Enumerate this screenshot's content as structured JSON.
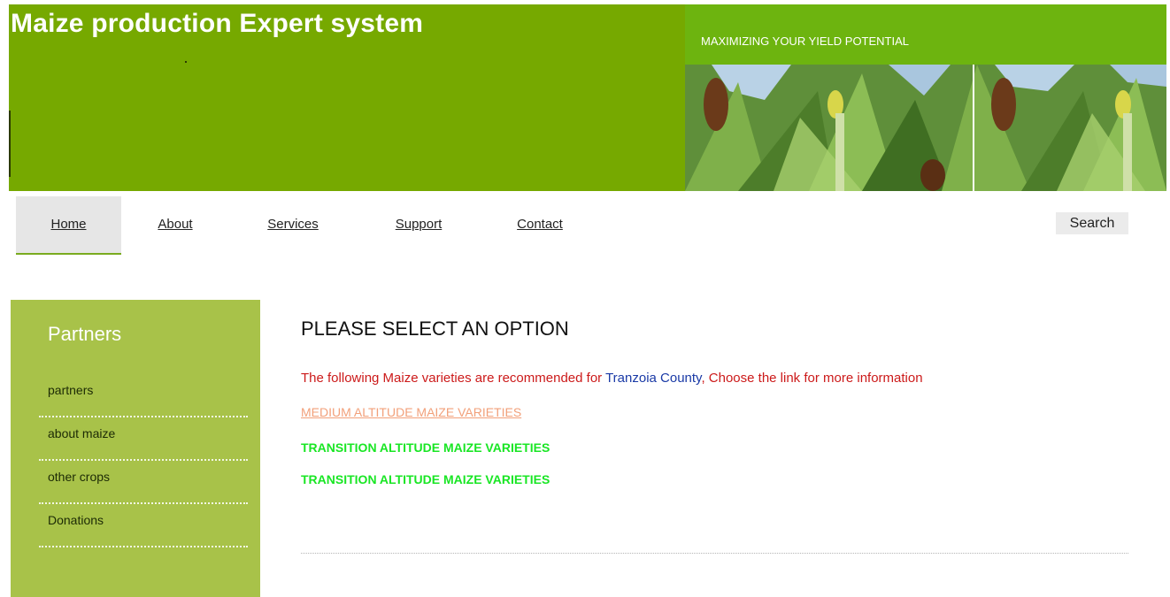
{
  "header": {
    "site_title": "Maize production Expert system",
    "tagline": "MAXIMIZING YOUR YIELD POTENTIAL",
    "brand_color": "#76a900"
  },
  "nav": {
    "items": [
      {
        "label": "Home",
        "active": true
      },
      {
        "label": "About"
      },
      {
        "label": "Services"
      },
      {
        "label": "Support"
      },
      {
        "label": "Contact"
      }
    ],
    "search_label": "Search"
  },
  "sidebar": {
    "title": "Partners",
    "items": [
      {
        "label": "partners"
      },
      {
        "label": "about maize"
      },
      {
        "label": "other crops"
      },
      {
        "label": "Donations"
      }
    ]
  },
  "main": {
    "heading": "PLEASE SELECT AN OPTION",
    "recommend_prefix": "The following Maize varieties are recommended for ",
    "county": "Tranzoia County",
    "recommend_suffix": ", Choose the link for more information",
    "links": [
      {
        "label": "MEDIUM ALTITUDE MAIZE VARIETIES"
      },
      {
        "label": "TRANSITION ALTITUDE MAIZE VARIETIES"
      },
      {
        "label": "TRANSITION ALTITUDE MAIZE VARIETIES"
      }
    ]
  }
}
